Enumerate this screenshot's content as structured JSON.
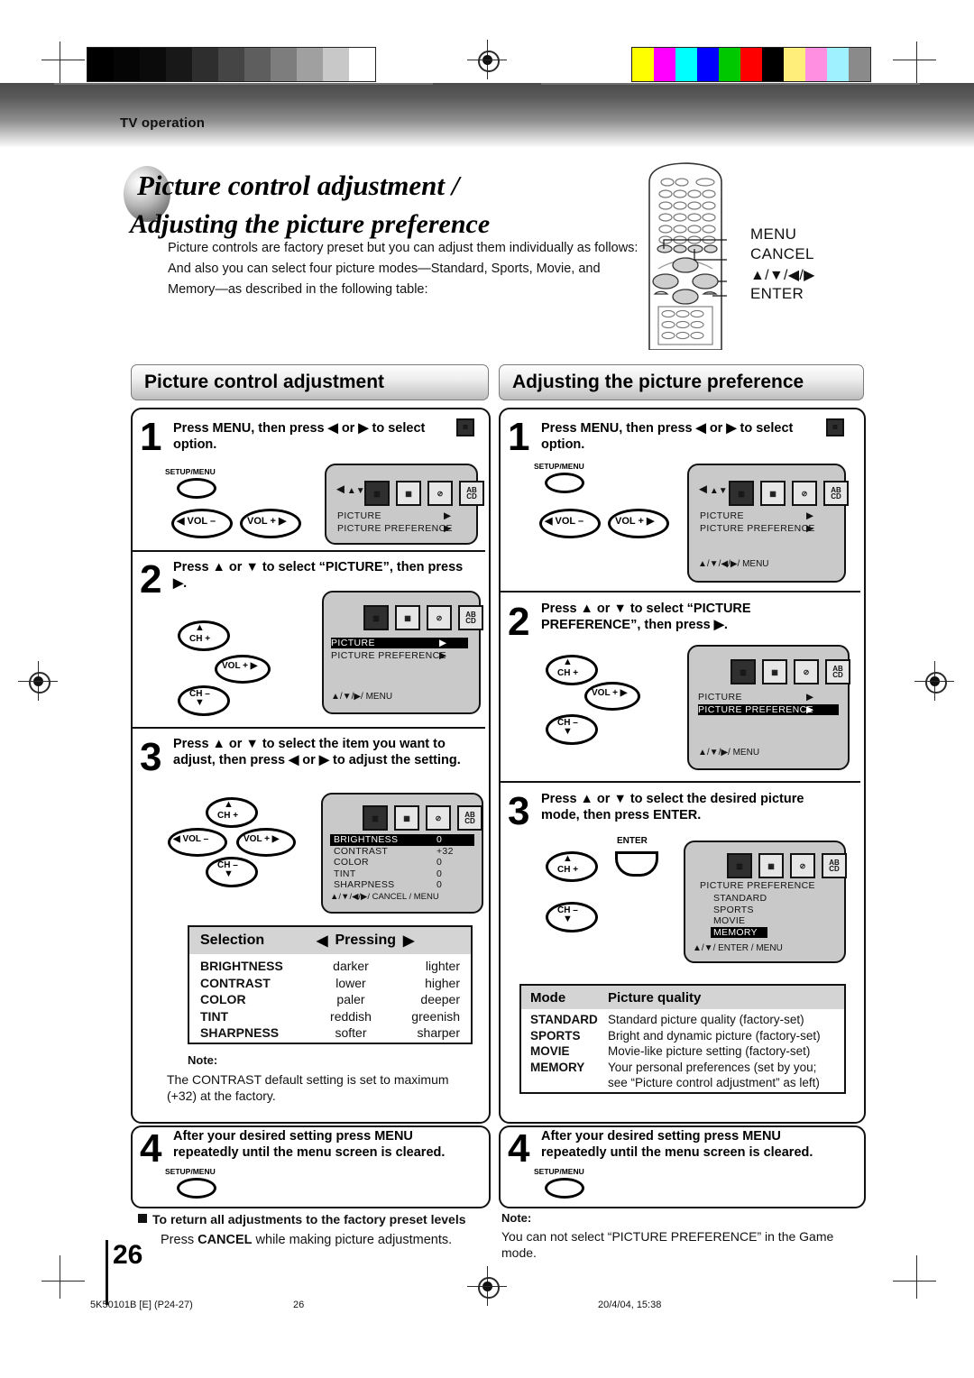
{
  "header": {
    "section_label": "TV operation"
  },
  "title": {
    "line1": "Picture control adjustment /",
    "line2": "Adjusting the picture preference"
  },
  "intro": {
    "line1": "Picture controls are factory preset but you can adjust them individually as follows:",
    "line2": "And also you can select four picture modes—Standard, Sports, Movie, and",
    "line3": "Memory—as described in the following table:"
  },
  "remote_callouts": [
    {
      "label": "MENU"
    },
    {
      "label": "CANCEL"
    },
    {
      "label": "▲/▼/◀/▶"
    },
    {
      "label": "ENTER"
    }
  ],
  "left_column": {
    "section_title": "Picture control adjustment",
    "steps": [
      {
        "number": "1",
        "text_line1": "Press MENU, then press ◀ or ▶ to select",
        "text_line2": "option.",
        "keys": [
          {
            "label": "SETUP/MENU",
            "caption": ""
          },
          {
            "label": "",
            "caption": "◀ VOL –"
          },
          {
            "label": "",
            "caption": "VOL + ▶"
          }
        ],
        "osd": {
          "has_navpad": true,
          "rows": [
            {
              "text": "PICTURE",
              "arrow": "▶",
              "highlight": false
            },
            {
              "text": "PICTURE  PREFERENCE",
              "arrow": "▶",
              "highlight": false
            }
          ],
          "footer": ""
        }
      },
      {
        "number": "2",
        "text_line1": "Press ▲ or ▼ to select “PICTURE”, then press",
        "text_line2": "▶.",
        "keys": [
          {
            "caption": "CH +"
          },
          {
            "caption": "VOL + ▶"
          },
          {
            "caption": "CH –"
          }
        ],
        "osd": {
          "has_navpad": false,
          "rows": [
            {
              "text": "PICTURE",
              "arrow": "▶",
              "highlight": true
            },
            {
              "text": "PICTURE  PREFERENCE",
              "arrow": "▶",
              "highlight": false
            }
          ],
          "footer": "▲/▼/▶/ MENU"
        }
      },
      {
        "number": "3",
        "text_line1": "Press ▲ or ▼ to select the item you want to",
        "text_line2": "adjust, then press ◀ or ▶ to adjust the setting.",
        "keys": [
          {
            "caption": "CH +"
          },
          {
            "caption": "◀ VOL –"
          },
          {
            "caption": "VOL + ▶"
          },
          {
            "caption": "CH –"
          }
        ],
        "osd": {
          "has_navpad": false,
          "items": [
            {
              "name": "BRIGHTNESS",
              "value": "0",
              "highlight": true
            },
            {
              "name": "CONTRAST",
              "value": "+32",
              "highlight": false
            },
            {
              "name": "COLOR",
              "value": "0",
              "highlight": false
            },
            {
              "name": "TINT",
              "value": "0",
              "highlight": false
            },
            {
              "name": "SHARPNESS",
              "value": "0",
              "highlight": false
            }
          ],
          "footer": "▲/▼/◀/▶/ CANCEL / MENU"
        }
      },
      {
        "number": "4",
        "text_line1": "After your desired setting press MENU",
        "text_line2": "repeatedly until the menu screen is cleared.",
        "keys": [
          {
            "label": "SETUP/MENU"
          }
        ]
      }
    ],
    "selection_table": {
      "head_left": "Selection",
      "head_right_left_arrow": "◀",
      "head_right": "Pressing",
      "head_right_right_arrow": "▶",
      "rows": [
        {
          "selection": "BRIGHTNESS",
          "left": "darker",
          "right": "lighter"
        },
        {
          "selection": "CONTRAST",
          "left": "lower",
          "right": "higher"
        },
        {
          "selection": "COLOR",
          "left": "paler",
          "right": "deeper"
        },
        {
          "selection": "TINT",
          "left": "reddish",
          "right": "greenish"
        },
        {
          "selection": "SHARPNESS",
          "left": "softer",
          "right": "sharper"
        }
      ]
    },
    "note": {
      "title": "Note:",
      "line1": "The CONTRAST default setting is set to maximum",
      "line2": "(+32) at the factory."
    },
    "footer_note": {
      "heading": "To return all adjustments to the factory preset levels",
      "body_pre": "Press ",
      "body_bold": "CANCEL",
      "body_post": " while making picture adjustments."
    }
  },
  "right_column": {
    "section_title": "Adjusting the picture preference",
    "steps": [
      {
        "number": "1",
        "text_line1": "Press MENU, then press ◀ or ▶ to select",
        "text_line2": "option.",
        "keys": [
          {
            "label": "SETUP/MENU"
          },
          {
            "caption": "◀ VOL –"
          },
          {
            "caption": "VOL + ▶"
          }
        ],
        "osd": {
          "has_navpad": true,
          "rows": [
            {
              "text": "PICTURE",
              "arrow": "▶",
              "highlight": false
            },
            {
              "text": "PICTURE  PREFERENCE",
              "arrow": "▶",
              "highlight": false
            }
          ],
          "footer": "▲/▼/◀/▶/ MENU"
        }
      },
      {
        "number": "2",
        "text_line1": "Press ▲ or ▼ to select “PICTURE",
        "text_line2": "PREFERENCE”, then press ▶.",
        "keys": [
          {
            "caption": "CH +"
          },
          {
            "caption": "VOL + ▶"
          },
          {
            "caption": "CH –"
          }
        ],
        "osd": {
          "has_navpad": false,
          "rows": [
            {
              "text": "PICTURE",
              "arrow": "▶",
              "highlight": false
            },
            {
              "text": "PICTURE  PREFERENCE",
              "arrow": "▶",
              "highlight": true
            }
          ],
          "footer": "▲/▼/▶/ MENU"
        }
      },
      {
        "number": "3",
        "text_line1": "Press ▲ or ▼ to select the desired picture",
        "text_line2": "mode, then press ENTER.",
        "keys": [
          {
            "caption": "CH +"
          },
          {
            "label": "ENTER"
          },
          {
            "caption": "CH –"
          }
        ],
        "osd": {
          "has_navpad": false,
          "title": "PICTURE PREFERENCE",
          "items": [
            {
              "name": "STANDARD",
              "highlight": false
            },
            {
              "name": "SPORTS",
              "highlight": false
            },
            {
              "name": "MOVIE",
              "highlight": false
            },
            {
              "name": "MEMORY",
              "highlight": true
            }
          ],
          "footer": "▲/▼/ ENTER / MENU"
        }
      },
      {
        "number": "4",
        "text_line1": "After your desired setting press MENU",
        "text_line2": "repeatedly until the menu screen is cleared.",
        "keys": [
          {
            "label": "SETUP/MENU"
          }
        ]
      }
    ],
    "mode_table": {
      "head_mode": "Mode",
      "head_quality": "Picture quality",
      "rows": [
        {
          "mode": "STANDARD",
          "quality": "Standard picture quality (factory-set)"
        },
        {
          "mode": "SPORTS",
          "quality": "Bright and dynamic picture (factory-set)"
        },
        {
          "mode": "MOVIE",
          "quality": "Movie-like picture setting (factory-set)"
        },
        {
          "mode": "MEMORY",
          "quality": "Your personal preferences (set by you;"
        },
        {
          "mode": "",
          "quality": "see “Picture control adjustment” as left)"
        }
      ]
    },
    "note": {
      "title": "Note:",
      "line1": "You can not select “PICTURE PREFERENCE” in the Game",
      "line2": "mode."
    }
  },
  "page": {
    "number": "26",
    "footer_left": "5K50101B [E] (P24-27)",
    "footer_center": "26",
    "footer_right": "20/4/04, 15:38"
  },
  "calibration": {
    "gray_steps": [
      "#000000",
      "#050505",
      "#0b0b0b",
      "#181818",
      "#2e2e2e",
      "#454545",
      "#5e5e5e",
      "#7d7d7d",
      "#a0a0a0",
      "#c8c8c8",
      "#ffffff"
    ],
    "color_steps": [
      "#ffff00",
      "#ff00ff",
      "#00ffff",
      "#0000ff",
      "#00c800",
      "#ff0000",
      "#000000",
      "#ffef7a",
      "#ff8fe0",
      "#9ff1ff",
      "#8a8a8a"
    ]
  }
}
